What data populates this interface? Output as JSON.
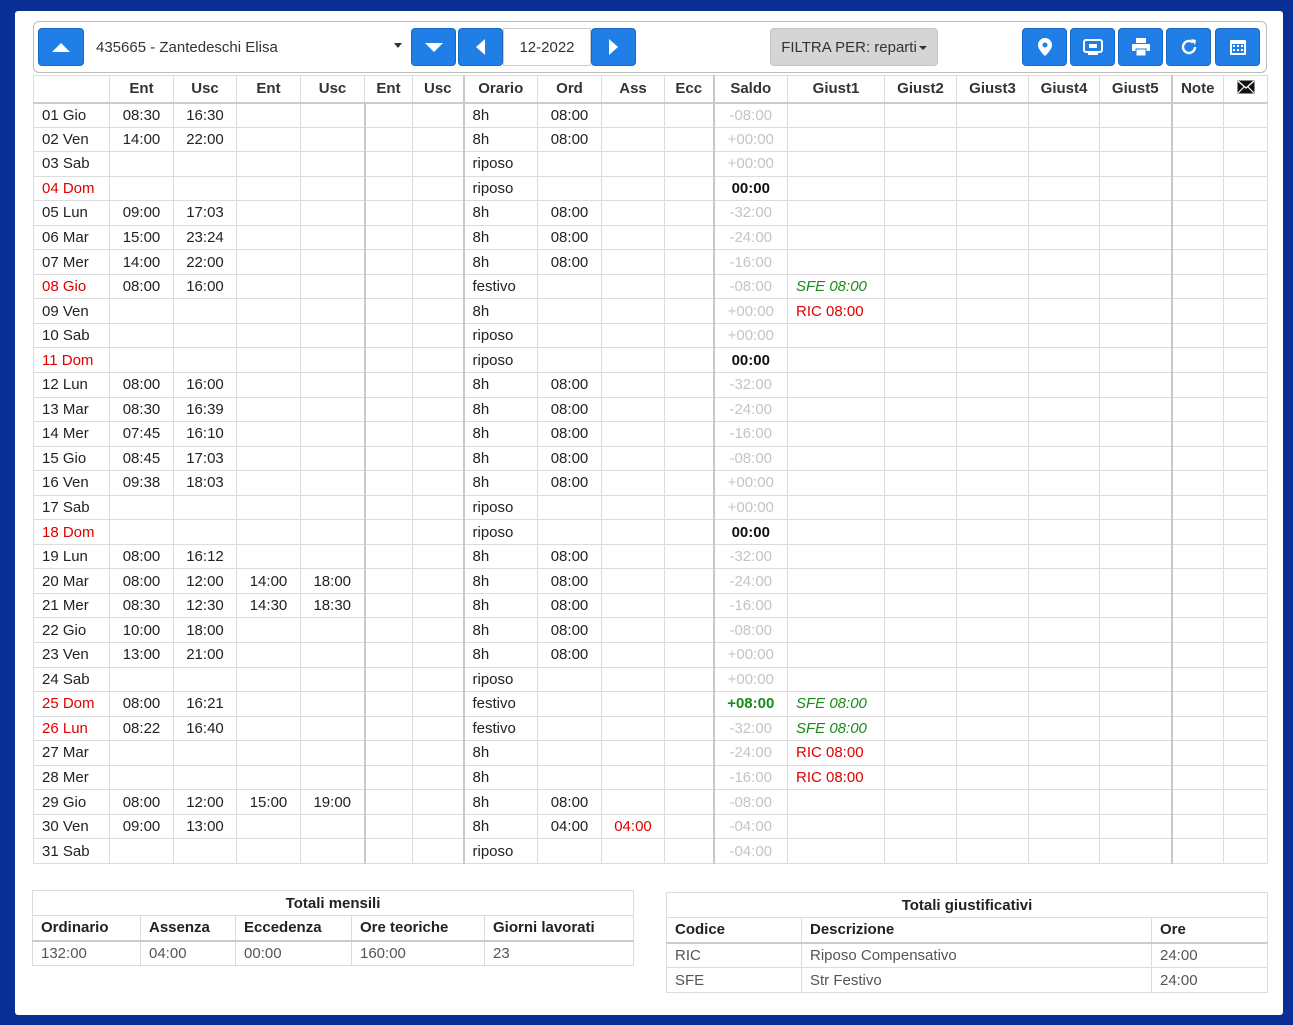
{
  "toolbar": {
    "employee": "435665 - Zantedeschi Elisa",
    "month": "12-2022",
    "filter_label": "FILTRA PER: reparti"
  },
  "colors": {
    "accent": "#1f7fe6",
    "page_bg": "#0a2f94",
    "weekend": "#e00000",
    "positive": "#1a8a1a"
  },
  "icons": [
    "arrow-up-icon",
    "arrow-down-icon",
    "arrow-left-icon",
    "arrow-right-icon",
    "map-pin-icon",
    "tv-icon",
    "printer-icon",
    "refresh-icon",
    "calendar-icon",
    "mail-icon"
  ],
  "headers": [
    "",
    "Ent",
    "Usc",
    "Ent",
    "Usc",
    "Ent",
    "Usc",
    "Orario",
    "Ord",
    "Ass",
    "Ecc",
    "Saldo",
    "Giust1",
    "Giust2",
    "Giust3",
    "Giust4",
    "Giust5",
    "Note"
  ],
  "rows": [
    {
      "day": "01 Gio",
      "ent1": "08:30",
      "usc1": "16:30",
      "ent2": "",
      "usc2": "",
      "orario": "8h",
      "ord": "08:00",
      "ass": "",
      "saldo": "-08:00",
      "giust1": ""
    },
    {
      "day": "02 Ven",
      "ent1": "14:00",
      "usc1": "22:00",
      "ent2": "",
      "usc2": "",
      "orario": "8h",
      "ord": "08:00",
      "ass": "",
      "saldo": "+00:00",
      "giust1": ""
    },
    {
      "day": "03 Sab",
      "ent1": "",
      "usc1": "",
      "ent2": "",
      "usc2": "",
      "orario": "riposo",
      "ord": "",
      "ass": "",
      "saldo": "+00:00",
      "giust1": ""
    },
    {
      "day": "04 Dom",
      "ent1": "",
      "usc1": "",
      "ent2": "",
      "usc2": "",
      "orario": "riposo",
      "ord": "",
      "ass": "",
      "saldo": "00:00",
      "giust1": ""
    },
    {
      "day": "05 Lun",
      "ent1": "09:00",
      "usc1": "17:03",
      "ent2": "",
      "usc2": "",
      "orario": "8h",
      "ord": "08:00",
      "ass": "",
      "saldo": "-32:00",
      "giust1": ""
    },
    {
      "day": "06 Mar",
      "ent1": "15:00",
      "usc1": "23:24",
      "ent2": "",
      "usc2": "",
      "orario": "8h",
      "ord": "08:00",
      "ass": "",
      "saldo": "-24:00",
      "giust1": ""
    },
    {
      "day": "07 Mer",
      "ent1": "14:00",
      "usc1": "22:00",
      "ent2": "",
      "usc2": "",
      "orario": "8h",
      "ord": "08:00",
      "ass": "",
      "saldo": "-16:00",
      "giust1": ""
    },
    {
      "day": "08 Gio",
      "ent1": "08:00",
      "usc1": "16:00",
      "ent2": "",
      "usc2": "",
      "orario": "festivo",
      "ord": "",
      "ass": "",
      "saldo": "-08:00",
      "giust1": "SFE 08:00"
    },
    {
      "day": "09 Ven",
      "ent1": "",
      "usc1": "",
      "ent2": "",
      "usc2": "",
      "orario": "8h",
      "ord": "",
      "ass": "",
      "saldo": "+00:00",
      "giust1": "RIC 08:00"
    },
    {
      "day": "10 Sab",
      "ent1": "",
      "usc1": "",
      "ent2": "",
      "usc2": "",
      "orario": "riposo",
      "ord": "",
      "ass": "",
      "saldo": "+00:00",
      "giust1": ""
    },
    {
      "day": "11 Dom",
      "ent1": "",
      "usc1": "",
      "ent2": "",
      "usc2": "",
      "orario": "riposo",
      "ord": "",
      "ass": "",
      "saldo": "00:00",
      "giust1": ""
    },
    {
      "day": "12 Lun",
      "ent1": "08:00",
      "usc1": "16:00",
      "ent2": "",
      "usc2": "",
      "orario": "8h",
      "ord": "08:00",
      "ass": "",
      "saldo": "-32:00",
      "giust1": ""
    },
    {
      "day": "13 Mar",
      "ent1": "08:30",
      "usc1": "16:39",
      "ent2": "",
      "usc2": "",
      "orario": "8h",
      "ord": "08:00",
      "ass": "",
      "saldo": "-24:00",
      "giust1": ""
    },
    {
      "day": "14 Mer",
      "ent1": "07:45",
      "usc1": "16:10",
      "ent2": "",
      "usc2": "",
      "orario": "8h",
      "ord": "08:00",
      "ass": "",
      "saldo": "-16:00",
      "giust1": ""
    },
    {
      "day": "15 Gio",
      "ent1": "08:45",
      "usc1": "17:03",
      "ent2": "",
      "usc2": "",
      "orario": "8h",
      "ord": "08:00",
      "ass": "",
      "saldo": "-08:00",
      "giust1": ""
    },
    {
      "day": "16 Ven",
      "ent1": "09:38",
      "usc1": "18:03",
      "ent2": "",
      "usc2": "",
      "orario": "8h",
      "ord": "08:00",
      "ass": "",
      "saldo": "+00:00",
      "giust1": ""
    },
    {
      "day": "17 Sab",
      "ent1": "",
      "usc1": "",
      "ent2": "",
      "usc2": "",
      "orario": "riposo",
      "ord": "",
      "ass": "",
      "saldo": "+00:00",
      "giust1": ""
    },
    {
      "day": "18 Dom",
      "ent1": "",
      "usc1": "",
      "ent2": "",
      "usc2": "",
      "orario": "riposo",
      "ord": "",
      "ass": "",
      "saldo": "00:00",
      "giust1": ""
    },
    {
      "day": "19 Lun",
      "ent1": "08:00",
      "usc1": "16:12",
      "ent2": "",
      "usc2": "",
      "orario": "8h",
      "ord": "08:00",
      "ass": "",
      "saldo": "-32:00",
      "giust1": ""
    },
    {
      "day": "20 Mar",
      "ent1": "08:00",
      "usc1": "12:00",
      "ent2": "14:00",
      "usc2": "18:00",
      "orario": "8h",
      "ord": "08:00",
      "ass": "",
      "saldo": "-24:00",
      "giust1": ""
    },
    {
      "day": "21 Mer",
      "ent1": "08:30",
      "usc1": "12:30",
      "ent2": "14:30",
      "usc2": "18:30",
      "orario": "8h",
      "ord": "08:00",
      "ass": "",
      "saldo": "-16:00",
      "giust1": ""
    },
    {
      "day": "22 Gio",
      "ent1": "10:00",
      "usc1": "18:00",
      "ent2": "",
      "usc2": "",
      "orario": "8h",
      "ord": "08:00",
      "ass": "",
      "saldo": "-08:00",
      "giust1": ""
    },
    {
      "day": "23 Ven",
      "ent1": "13:00",
      "usc1": "21:00",
      "ent2": "",
      "usc2": "",
      "orario": "8h",
      "ord": "08:00",
      "ass": "",
      "saldo": "+00:00",
      "giust1": ""
    },
    {
      "day": "24 Sab",
      "ent1": "",
      "usc1": "",
      "ent2": "",
      "usc2": "",
      "orario": "riposo",
      "ord": "",
      "ass": "",
      "saldo": "+00:00",
      "giust1": ""
    },
    {
      "day": "25 Dom",
      "ent1": "08:00",
      "usc1": "16:21",
      "ent2": "",
      "usc2": "",
      "orario": "festivo",
      "ord": "",
      "ass": "",
      "saldo": "+08:00",
      "giust1": "SFE 08:00"
    },
    {
      "day": "26 Lun",
      "ent1": "08:22",
      "usc1": "16:40",
      "ent2": "",
      "usc2": "",
      "orario": "festivo",
      "ord": "",
      "ass": "",
      "saldo": "-32:00",
      "giust1": "SFE 08:00"
    },
    {
      "day": "27 Mar",
      "ent1": "",
      "usc1": "",
      "ent2": "",
      "usc2": "",
      "orario": "8h",
      "ord": "",
      "ass": "",
      "saldo": "-24:00",
      "giust1": "RIC 08:00"
    },
    {
      "day": "28 Mer",
      "ent1": "",
      "usc1": "",
      "ent2": "",
      "usc2": "",
      "orario": "8h",
      "ord": "",
      "ass": "",
      "saldo": "-16:00",
      "giust1": "RIC 08:00"
    },
    {
      "day": "29 Gio",
      "ent1": "08:00",
      "usc1": "12:00",
      "ent2": "15:00",
      "usc2": "19:00",
      "orario": "8h",
      "ord": "08:00",
      "ass": "",
      "saldo": "-08:00",
      "giust1": ""
    },
    {
      "day": "30 Ven",
      "ent1": "09:00",
      "usc1": "13:00",
      "ent2": "",
      "usc2": "",
      "orario": "8h",
      "ord": "04:00",
      "ass": "04:00",
      "saldo": "-04:00",
      "giust1": ""
    },
    {
      "day": "31 Sab",
      "ent1": "",
      "usc1": "",
      "ent2": "",
      "usc2": "",
      "orario": "riposo",
      "ord": "",
      "ass": "",
      "saldo": "-04:00",
      "giust1": ""
    }
  ],
  "totali_mensili": {
    "caption": "Totali mensili",
    "headers": [
      "Ordinario",
      "Assenza",
      "Eccedenza",
      "Ore teoriche",
      "Giorni lavorati"
    ],
    "values": [
      "132:00",
      "04:00",
      "00:00",
      "160:00",
      "23"
    ]
  },
  "totali_giustificativi": {
    "caption": "Totali giustificativi",
    "headers": [
      "Codice",
      "Descrizione",
      "Ore"
    ],
    "rows": [
      {
        "codice": "RIC",
        "descrizione": "Riposo Compensativo",
        "ore": "24:00"
      },
      {
        "codice": "SFE",
        "descrizione": "Str Festivo",
        "ore": "24:00"
      }
    ]
  }
}
